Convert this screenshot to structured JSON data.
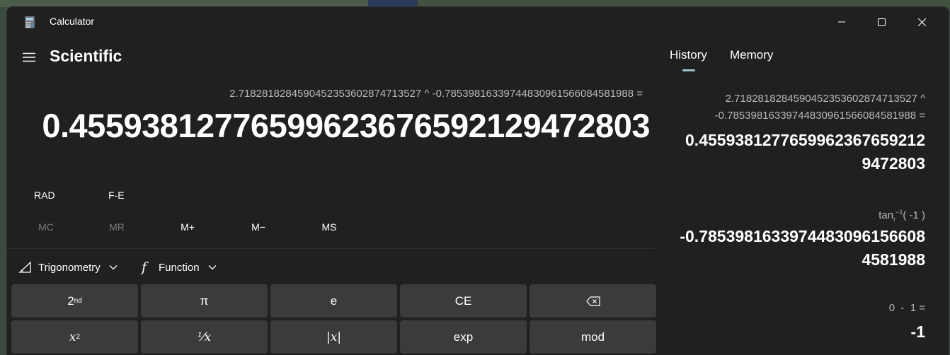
{
  "window": {
    "title": "Calculator",
    "controls": [
      "minimize",
      "maximize",
      "close"
    ]
  },
  "header": {
    "mode": "Scientific"
  },
  "display": {
    "expression": "2.718281828459045235360287471352​7 ^ -0.7853981633974483096156608458198​8 =",
    "result": "0.4559381277659962367659212947280​3"
  },
  "toggles": {
    "angle": "RAD",
    "fe": "F-E"
  },
  "memory": {
    "mc": "MC",
    "mr": "MR",
    "mplus": "M+",
    "mminus": "M−",
    "ms": "MS"
  },
  "dropdowns": {
    "trig": "Trigonometry",
    "func": "Function"
  },
  "keys": {
    "row1": {
      "second": "2",
      "second_sup": "nd",
      "pi": "π",
      "e": "e",
      "ce": "CE"
    },
    "row2": {
      "square": "x",
      "square_sup": "2",
      "reciprocal": "⅟x",
      "abs": "|x|",
      "exp": "exp",
      "mod": "mod"
    }
  },
  "tabs": {
    "history": "History",
    "memory": "Memory"
  },
  "history": [
    {
      "expr_line1": "2.718281828459045235360287471352​7   ^",
      "expr_line2": "-0.7853981633974483096156608458198​8 =",
      "result_line1": "0.45593812776599623676592​12",
      "result_line2": "9472803"
    },
    {
      "expr_prefix": "tan",
      "expr_sub": "r",
      "expr_sup": "−1",
      "expr_suffix": "( -1 )",
      "result_line1": "-0.785398163397448309615660​8",
      "result_line2": "4581988"
    },
    {
      "expr_line1": "0  -  1 =",
      "result_line1": "-1"
    }
  ],
  "colors": {
    "window_bg": "#202020",
    "key_bg": "#3b3b3b",
    "accent": "#9bc3cf",
    "muted_text": "#b8b8b8",
    "disabled_text": "#7a7a7a"
  }
}
